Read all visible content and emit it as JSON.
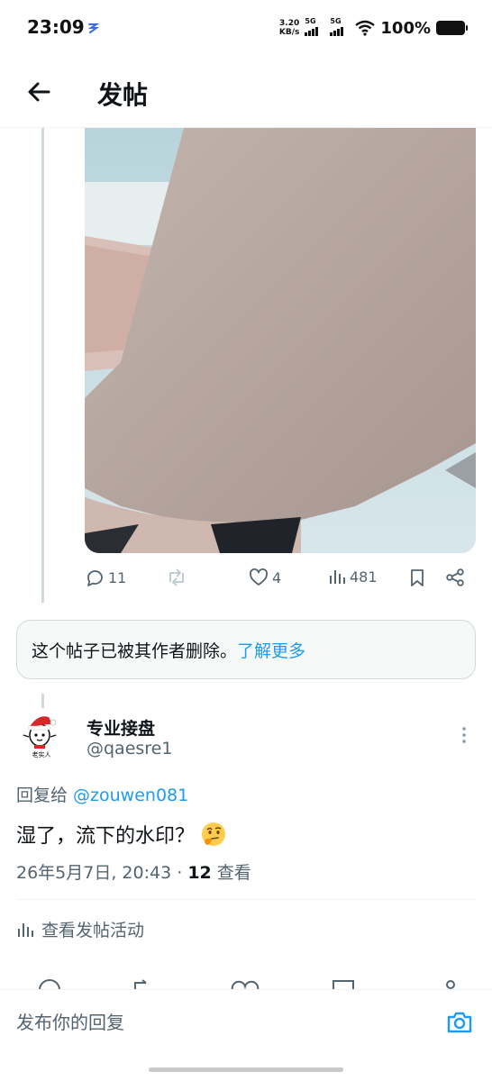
{
  "status_bar": {
    "time": "23:09",
    "net_speed_value": "3.20",
    "net_speed_unit": "KB/s",
    "sim1_label": "5G",
    "sim2_label": "5G",
    "battery": "100%"
  },
  "header": {
    "title": "发帖",
    "back_icon": "arrow-left-icon"
  },
  "post": {
    "media_description": "photo",
    "actions": {
      "replies": "11",
      "retweets": "",
      "likes": "4",
      "views": "481"
    }
  },
  "deleted_notice": {
    "text": "这个帖子已被其作者删除。",
    "link": "了解更多"
  },
  "reply": {
    "display_name": "专业接盘",
    "handle": "@qaesre1",
    "avatar_caption": "老实人",
    "reply_to_label": "回复给 ",
    "reply_to_mention": "@zouwen081",
    "text": "湿了，流下的水印？",
    "emoji": "thinking-face-icon",
    "date": "26年5月7日, 20:43 · ",
    "view_count": "12",
    "view_label": " 查看",
    "activity_label": "查看发帖活动"
  },
  "composer": {
    "placeholder": "发布你的回复"
  },
  "colors": {
    "accent": "#1d9bf0",
    "secondary_text": "#536471",
    "border": "#cfd9de"
  }
}
